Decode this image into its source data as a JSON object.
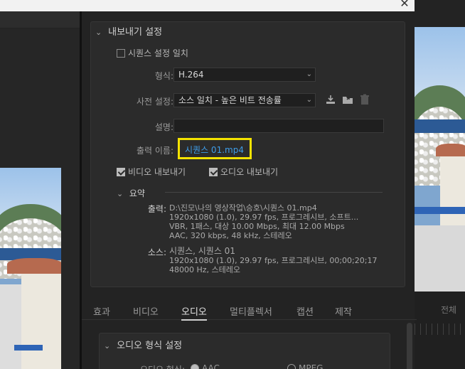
{
  "window": {
    "close_glyph": "✕"
  },
  "export": {
    "header": "내보내기 설정",
    "match_sequence_label": "시퀀스 설정 일치",
    "format": {
      "label": "형식:",
      "value": "H.264"
    },
    "preset": {
      "label": "사전 설정:",
      "value": "소스 일치 - 높은 비트 전송률"
    },
    "comments": {
      "label": "설명:",
      "value": ""
    },
    "output_name": {
      "label": "출력 이름:",
      "value": "시퀀스 01.mp4"
    },
    "export_video_label": "비디오 내보내기",
    "export_audio_label": "오디오 내보내기",
    "summary": {
      "header": "요약",
      "output_label": "출력:",
      "output_lines": [
        "D:\\진모\\나의 영상작업\\승호\\시퀀스 01.mp4",
        "1920x1080 (1.0), 29.97 fps, 프로그레시브, 소프트...",
        "VBR, 1패스, 대상 10.00 Mbps, 최대 12.00 Mbps",
        "AAC, 320 kbps, 48 kHz, 스테레오"
      ],
      "source_label": "소스:",
      "source_lines": [
        "시퀀스, 시퀀스 01",
        "1920x1080 (1.0), 29.97 fps, 프로그레시브, 00;00;20;17",
        "48000 Hz, 스테레오"
      ]
    }
  },
  "tabs": [
    "효과",
    "비디오",
    "오디오",
    "멀티플렉서",
    "캡션",
    "제작"
  ],
  "active_tab": "오디오",
  "audio": {
    "header": "오디오 형식 설정",
    "format_label": "오디오 형식:",
    "options": [
      "AAC",
      "MPEG"
    ]
  },
  "right_panel": {
    "all_label": "전체"
  },
  "colors": {
    "highlight_box": "#f5e300",
    "output_name_text": "#3e9de8"
  },
  "icons": [
    "chevron-down-icon",
    "save-preset-icon",
    "import-preset-icon",
    "trash-icon",
    "close-icon"
  ]
}
